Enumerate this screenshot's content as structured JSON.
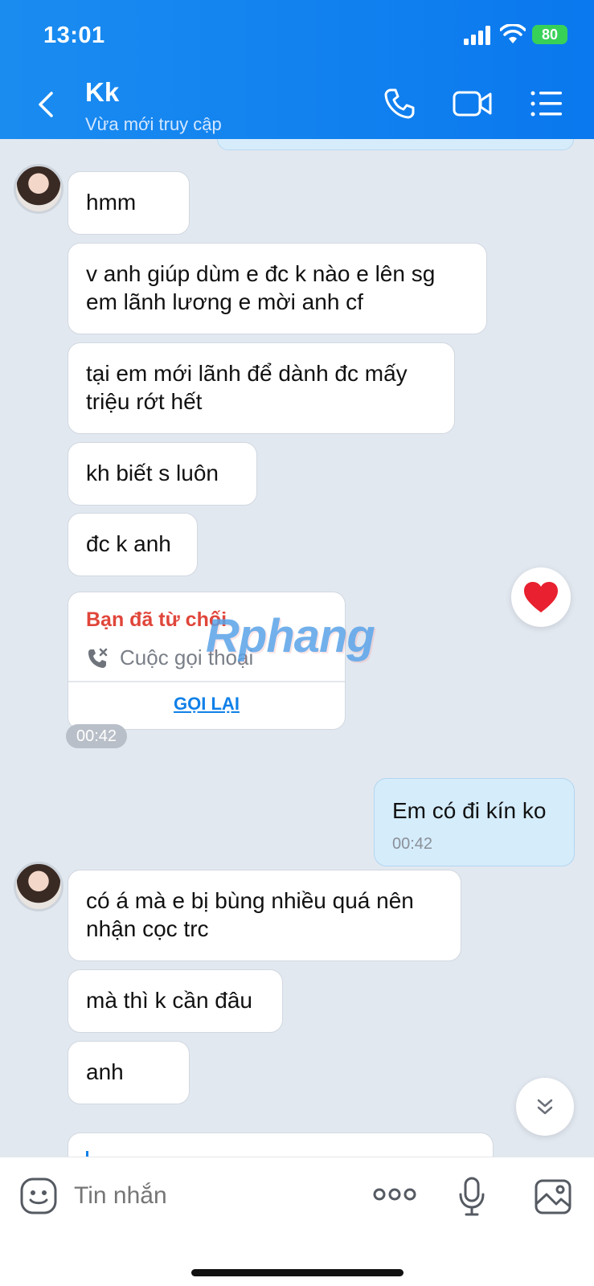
{
  "status_bar": {
    "time": "13:01",
    "battery": "80"
  },
  "header": {
    "contact_name": "Kk",
    "contact_status": "Vừa mới truy cập"
  },
  "messages": [
    {
      "text": "hmm"
    },
    {
      "text": "v anh giúp dùm e đc k nào e lên sg em lãnh lương e mời anh cf"
    },
    {
      "text": "tại em mới lãnh để dành đc mấy triệu rớt hết"
    },
    {
      "text": "kh biết s luôn"
    },
    {
      "text": "đc k anh"
    }
  ],
  "call_card": {
    "title": "Bạn đã từ chối",
    "subtitle": "Cuộc gọi thoại",
    "action": "GỌI LẠI",
    "time": "00:42"
  },
  "watermark": "Rphang",
  "my_message": {
    "text": "Em có đi kín ko",
    "time": "00:42"
  },
  "messages_2": [
    {
      "text": "có á mà e bị bùng nhiều quá nên nhận cọc trc"
    },
    {
      "text": "mà thì k cần đâu"
    },
    {
      "text": "anh"
    }
  ],
  "composer": {
    "placeholder": "Tin nhắn"
  },
  "colors": {
    "header": "#0a78ee",
    "accent": "#1080e8",
    "declined": "#e0463a",
    "my_bubble": "#d5ecfb"
  }
}
